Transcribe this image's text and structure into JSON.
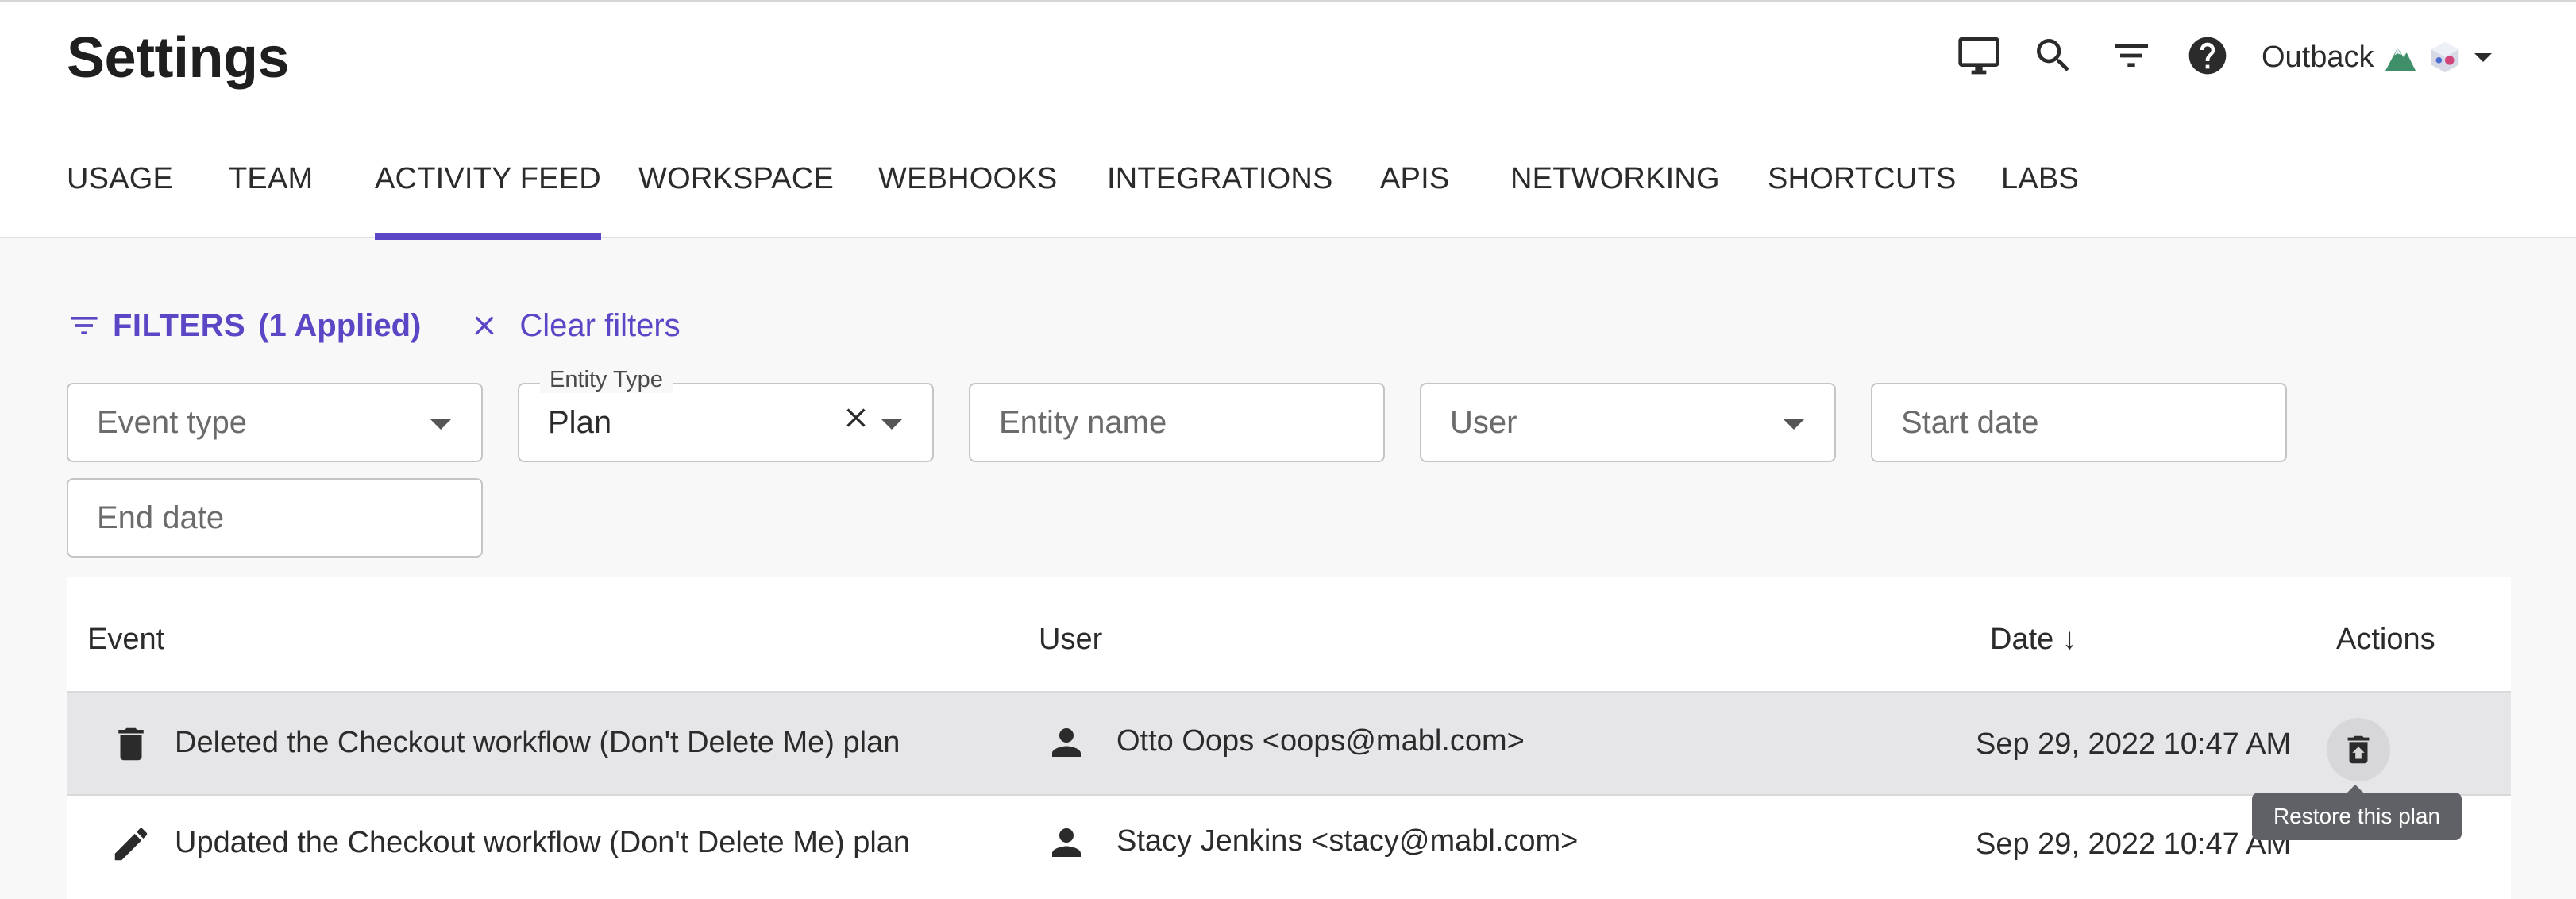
{
  "header": {
    "title": "Settings",
    "icons": [
      "monitor-icon",
      "search-icon",
      "filter-icon",
      "help-icon"
    ],
    "workspace": "Outback"
  },
  "tabs": [
    {
      "label": "USAGE",
      "active": false
    },
    {
      "label": "TEAM",
      "active": false
    },
    {
      "label": "ACTIVITY FEED",
      "active": true
    },
    {
      "label": "WORKSPACE",
      "active": false
    },
    {
      "label": "WEBHOOKS",
      "active": false
    },
    {
      "label": "INTEGRATIONS",
      "active": false
    },
    {
      "label": "APIS",
      "active": false
    },
    {
      "label": "NETWORKING",
      "active": false
    },
    {
      "label": "SHORTCUTS",
      "active": false
    },
    {
      "label": "LABS",
      "active": false
    }
  ],
  "filters": {
    "label": "FILTERS",
    "applied": "(1 Applied)",
    "clear": "Clear filters",
    "event_type": {
      "placeholder": "Event type"
    },
    "entity_type": {
      "label": "Entity Type",
      "value": "Plan"
    },
    "entity_name": {
      "placeholder": "Entity name"
    },
    "user": {
      "placeholder": "User"
    },
    "start_date": {
      "placeholder": "Start date"
    },
    "end_date": {
      "placeholder": "End date"
    }
  },
  "table": {
    "columns": {
      "event": "Event",
      "user": "User",
      "date": "Date ↓",
      "actions": "Actions"
    },
    "rows": [
      {
        "icon": "trash-icon",
        "event": "Deleted the Checkout workflow (Don't Delete Me) plan",
        "user": "Otto Oops <oops@mabl.com>",
        "date": "Sep 29, 2022 10:47 AM",
        "action_icon": "restore-icon"
      },
      {
        "icon": "pencil-icon",
        "event": "Updated the Checkout workflow (Don't Delete Me) plan",
        "user": "Stacy Jenkins <stacy@mabl.com>",
        "date": "Sep 29, 2022 10:47 AM"
      }
    ]
  },
  "tooltip": "Restore this plan",
  "colors": {
    "accent": "#5b47c6",
    "hover_row": "#e6e6e9",
    "tooltip_bg": "#5f6166"
  }
}
